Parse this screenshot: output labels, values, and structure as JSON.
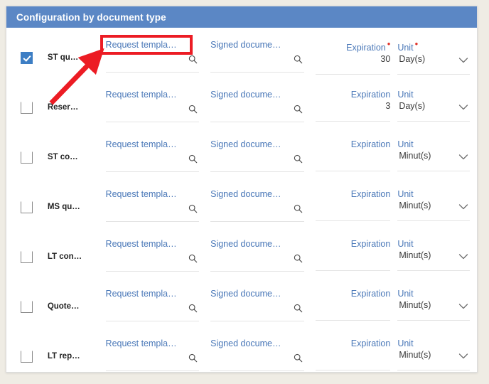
{
  "card": {
    "header_title": "Configuration by document type"
  },
  "columns": {
    "request_template_label": "Request templa…",
    "signed_document_label": "Signed docume…",
    "expiration_label": "Expiration",
    "unit_label": "Unit",
    "required_marker": "•",
    "search_icon": "search-icon",
    "chevron_icon": "chevron-down-icon"
  },
  "rows": [
    {
      "checked": true,
      "type_name": "ST qu…",
      "request_template": "Request templa…",
      "signed_document": "Signed docume…",
      "expiration_label": "Expiration",
      "expiration_required": true,
      "expiration_value": "30",
      "unit_label": "Unit",
      "unit_required": true,
      "unit_value": "Day(s)"
    },
    {
      "checked": false,
      "type_name": "Reser…",
      "request_template": "Request templa…",
      "signed_document": "Signed docume…",
      "expiration_label": "Expiration",
      "expiration_required": false,
      "expiration_value": "3",
      "unit_label": "Unit",
      "unit_required": false,
      "unit_value": "Day(s)"
    },
    {
      "checked": false,
      "type_name": "ST co…",
      "request_template": "Request templa…",
      "signed_document": "Signed docume…",
      "expiration_label": "Expiration",
      "expiration_required": false,
      "expiration_value": "",
      "unit_label": "Unit",
      "unit_required": false,
      "unit_value": "Minut(s)"
    },
    {
      "checked": false,
      "type_name": "MS qu…",
      "request_template": "Request templa…",
      "signed_document": "Signed docume…",
      "expiration_label": "Expiration",
      "expiration_required": false,
      "expiration_value": "",
      "unit_label": "Unit",
      "unit_required": false,
      "unit_value": "Minut(s)"
    },
    {
      "checked": false,
      "type_name": "LT con…",
      "request_template": "Request templa…",
      "signed_document": "Signed docume…",
      "expiration_label": "Expiration",
      "expiration_required": false,
      "expiration_value": "",
      "unit_label": "Unit",
      "unit_required": false,
      "unit_value": "Minut(s)"
    },
    {
      "checked": false,
      "type_name": "Quote…",
      "request_template": "Request templa…",
      "signed_document": "Signed docume…",
      "expiration_label": "Expiration",
      "expiration_required": false,
      "expiration_value": "",
      "unit_label": "Unit",
      "unit_required": false,
      "unit_value": "Minut(s)"
    },
    {
      "checked": false,
      "type_name": "LT rep…",
      "request_template": "Request templa…",
      "signed_document": "Signed docume…",
      "expiration_label": "Expiration",
      "expiration_required": false,
      "expiration_value": "",
      "unit_label": "Unit",
      "unit_required": false,
      "unit_value": "Minut(s)"
    }
  ],
  "annotation": {
    "highlight_target": "Request templa…",
    "color": "#ec1c24"
  },
  "colors": {
    "header_blue": "#5b87c5",
    "label_blue": "#4a78b8",
    "checkbox_blue": "#3d7ec4",
    "required_red": "#e03127",
    "annotation_red": "#ec1c24",
    "page_background": "#efece4"
  }
}
